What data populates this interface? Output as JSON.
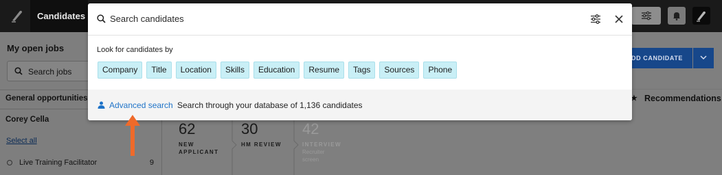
{
  "topbar": {
    "nav_tab": "Candidates"
  },
  "sidebar": {
    "title": "My open jobs",
    "search_placeholder": "Search jobs",
    "general": "General opportunities",
    "owner": "Corey Cella",
    "select_all": "Select all",
    "jobs": [
      {
        "name": "Live Training Facilitator",
        "count": "9"
      }
    ]
  },
  "main": {
    "add_candidate": "DD CANDIDATE",
    "recommendations": "Recommendations",
    "stages": [
      {
        "count": "62",
        "label_line1": "NEW",
        "label_line2": "APPLICANT"
      },
      {
        "count": "30",
        "label_line1": "HM REVIEW"
      },
      {
        "count": "42",
        "label_line1": "INTERVIEW",
        "sub1": "Recruiter",
        "sub2": "screen"
      }
    ]
  },
  "modal": {
    "search_placeholder": "Search candidates",
    "look_for_label": "Look for candidates by",
    "chips": [
      "Company",
      "Title",
      "Location",
      "Skills",
      "Education",
      "Resume",
      "Tags",
      "Sources",
      "Phone"
    ],
    "advanced_link": "Advanced search",
    "advanced_desc": "Search through your database of 1,136 candidates"
  },
  "colors": {
    "chip_bg": "#c9eff6",
    "link": "#1f73c8",
    "arrow": "#ef6a2a",
    "primary_button": "#17478a"
  }
}
